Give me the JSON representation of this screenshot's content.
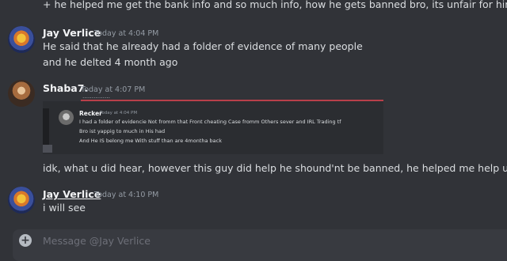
{
  "messages": {
    "top_continuation": "+ he helped me get the bank info and so much info, how he gets banned bro, its unfair for him.",
    "jay1": {
      "username": "Jay Verlice",
      "time": "Today at 4:04 PM",
      "lines": [
        "He said that he already had a folder of evidence of many people",
        "and he delted 4 month ago"
      ]
    },
    "shaba": {
      "username": "Shaba7.",
      "time": "Today at 4:07 PM",
      "embed": {
        "top_fragment": "……………",
        "user": "Recker",
        "time": "Today at 4:04 PM",
        "lines": [
          "I had a folder of evidencie Not fromm that Front cheating Case fromm Others sever and IRL Trading tf",
          "Bro ist yappig to much in His had",
          "And He IS belong me With stuff than are 4montha back"
        ]
      },
      "text": "idk, what u did hear, however this guy did help he shound'nt be banned, he helped me help u."
    },
    "jay2": {
      "username": "Jay Verlice",
      "time": "Today at 4:10 PM",
      "lines": [
        "i will see"
      ]
    }
  },
  "composer": {
    "placeholder": "Message @Jay Verlice",
    "attach_icon": "plus-icon"
  },
  "colors": {
    "background": "#313338",
    "username": "#f2f3f5",
    "timestamp": "#949ba4",
    "text": "#dbdee1",
    "input_bg": "#383a40"
  }
}
